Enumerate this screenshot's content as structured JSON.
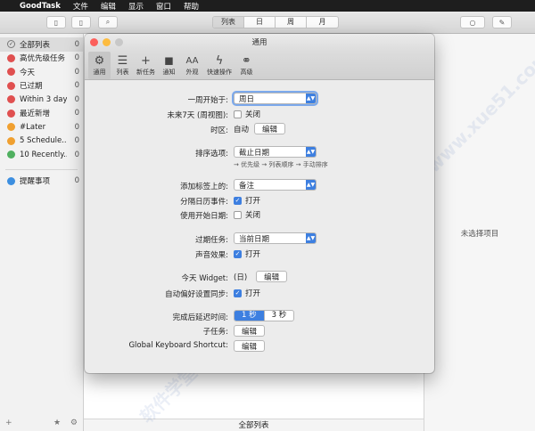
{
  "menubar": {
    "app": "GoodTask",
    "items": [
      "文件",
      "编辑",
      "显示",
      "窗口",
      "帮助"
    ]
  },
  "toolbar": {
    "views": [
      {
        "label": "列表",
        "active": true
      },
      {
        "label": "日",
        "active": false
      },
      {
        "label": "周",
        "active": false
      },
      {
        "label": "月",
        "active": false
      }
    ]
  },
  "sidebar": {
    "items": [
      {
        "label": "全部列表",
        "count": "0",
        "color": "#9a9a9a",
        "selected": true
      },
      {
        "label": "高优先级任务",
        "count": "0",
        "color": "#e05050",
        "selected": false
      },
      {
        "label": "今天",
        "count": "0",
        "color": "#e05050",
        "selected": false
      },
      {
        "label": "已过期",
        "count": "0",
        "color": "#e05050",
        "selected": false
      },
      {
        "label": "Within 3 days",
        "count": "0",
        "color": "#e05050",
        "selected": false
      },
      {
        "label": "最近新增",
        "count": "0",
        "color": "#e05050",
        "selected": false
      },
      {
        "label": "#Later",
        "count": "0",
        "color": "#f0a030",
        "selected": false
      },
      {
        "label": "5 Schedule...",
        "count": "0",
        "color": "#f0a030",
        "selected": false
      },
      {
        "label": "10 Recently...",
        "count": "0",
        "color": "#50b060",
        "selected": false
      }
    ],
    "reminders": {
      "label": "提醒事项",
      "count": "0",
      "color": "#3d8fe0"
    }
  },
  "main": {
    "footer_title": "全部列表",
    "detail_empty": "未选择项目"
  },
  "prefs": {
    "title": "通用",
    "tabs": [
      {
        "label": "通用",
        "icon": "gear-icon",
        "glyph": "⚙",
        "selected": true
      },
      {
        "label": "列表",
        "icon": "list-icon",
        "glyph": "☰",
        "selected": false
      },
      {
        "label": "新任务",
        "icon": "plus-icon",
        "glyph": "+",
        "selected": false
      },
      {
        "label": "通知",
        "icon": "notification-icon",
        "glyph": "◼",
        "selected": false
      },
      {
        "label": "外观",
        "icon": "font-icon",
        "glyph": "AA",
        "selected": false
      },
      {
        "label": "快速操作",
        "icon": "bolt-icon",
        "glyph": "ϟ",
        "selected": false
      },
      {
        "label": "高级",
        "icon": "gears-icon",
        "glyph": "⚭",
        "selected": false
      }
    ],
    "week_start": {
      "label": "一周开始于:",
      "value": "周日"
    },
    "next7": {
      "label": "未来7天 (周视图):",
      "check": "关闭",
      "checked": false
    },
    "timezone": {
      "label": "时区:",
      "value": "自动",
      "button": "编辑"
    },
    "sort": {
      "label": "排序选项:",
      "value": "截止日期",
      "hint": "→ 优先级 → 列表顺序 → 手动排序"
    },
    "add_tag": {
      "label": "添加标签上的:",
      "value": "备注"
    },
    "split_cal": {
      "label": "分隔日历事件:",
      "check": "打开",
      "checked": true
    },
    "use_start": {
      "label": "使用开始日期:",
      "check": "关闭",
      "checked": false
    },
    "overdue": {
      "label": "过期任务:",
      "value": "当前日期"
    },
    "sound": {
      "label": "声音效果:",
      "check": "打开",
      "checked": true
    },
    "widget": {
      "label": "今天 Widget:",
      "value": "(日)",
      "button": "编辑"
    },
    "autosync": {
      "label": "自动偏好设置同步:",
      "check": "打开",
      "checked": true
    },
    "delay": {
      "label": "完成后延迟时间:",
      "options": [
        "1 秒",
        "3 秒"
      ],
      "selected": 0
    },
    "subtask": {
      "label": "子任务:",
      "button": "编辑"
    },
    "shortcut": {
      "label": "Global Keyboard Shortcut:",
      "button": "编辑"
    }
  }
}
